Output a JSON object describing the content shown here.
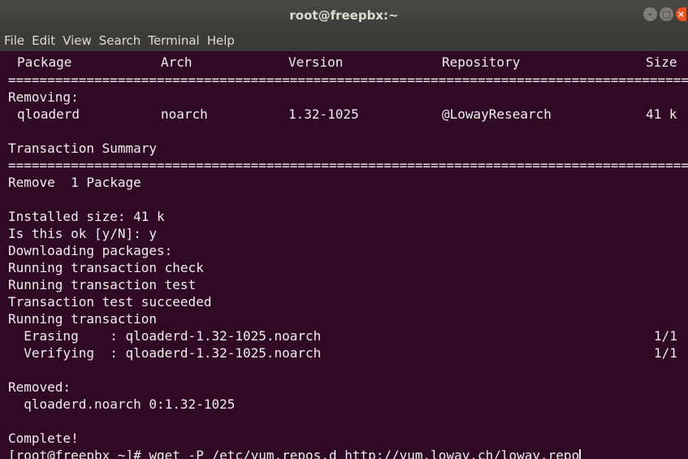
{
  "window": {
    "title": "root@freepbx:~",
    "controls": {
      "minimize": "–",
      "maximize": "□",
      "close": "×"
    }
  },
  "menu": [
    "File",
    "Edit",
    "View",
    "Search",
    "Terminal",
    "Help"
  ],
  "table": {
    "headers": {
      "package": "Package",
      "arch": "Arch",
      "version": "Version",
      "repository": "Repository",
      "size": "Size"
    },
    "separator": "=====================================================================================================================================================",
    "section": "Removing:",
    "row": {
      "package": "qloaderd",
      "arch": "noarch",
      "version": "1.32-1025",
      "repository": "@LowayResearch",
      "size": "41 k"
    }
  },
  "summary": {
    "heading": "Transaction Summary",
    "remove": "Remove  1 Package"
  },
  "output": [
    "Installed size: 41 k",
    "Is this ok [y/N]: y",
    "Downloading packages:",
    "Running transaction check",
    "Running transaction test",
    "Transaction test succeeded",
    "Running transaction"
  ],
  "steps": [
    {
      "label": "  Erasing    : qloaderd-1.32-1025.noarch",
      "count": "1/1"
    },
    {
      "label": "  Verifying  : qloaderd-1.32-1025.noarch",
      "count": "1/1"
    }
  ],
  "removed": {
    "heading": "Removed:",
    "item": "  qloaderd.noarch 0:1.32-1025"
  },
  "complete": "Complete!",
  "prompt": {
    "text": "[root@freepbx ~]# wget -P /etc/yum.repos.d http://yum.loway.ch/loway.repo"
  }
}
